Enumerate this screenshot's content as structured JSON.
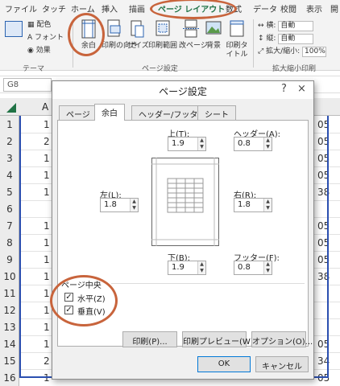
{
  "ribbon_tabs": [
    "ファイル",
    "タッチ",
    "ホーム",
    "挿入",
    "描画",
    "ページ レイアウト",
    "数式",
    "データ",
    "校閲",
    "表示",
    "開"
  ],
  "theme_group": {
    "colors": "配色",
    "fonts": "フォント",
    "effects": "効果",
    "label": "テーマ"
  },
  "page_setup_group": {
    "margins": "余白",
    "orientation": "印刷の向き",
    "size": "サイズ",
    "print_area": "印刷範囲",
    "breaks": "改ページ",
    "background": "背景",
    "print_titles": "印刷タイトル",
    "label": "ページ設定"
  },
  "scale_group": {
    "width_label": "横:",
    "width_value": "自動",
    "height_label": "縦:",
    "height_value": "自動",
    "scale_label": "拡大/縮小:",
    "scale_value": "100%",
    "label": "拡大縮小印刷"
  },
  "name_box": "G8",
  "column_header": "A",
  "row_numbers": [
    "1",
    "2",
    "3",
    "4",
    "5",
    "6",
    "7",
    "8",
    "9",
    "10",
    "11",
    "12",
    "13",
    "14",
    "15",
    "16"
  ],
  "col_a_values": [
    "1",
    "2",
    "1",
    "1",
    "1",
    "",
    "1",
    "1",
    "1",
    "1",
    "1",
    "1",
    "1",
    "1",
    "2",
    "1"
  ],
  "col_right_values": [
    "05",
    "05",
    "05",
    "05",
    "38",
    "",
    "05",
    "05",
    "05",
    "38",
    "",
    "",
    "",
    "05",
    "34",
    "05"
  ],
  "dialog": {
    "title": "ページ設定",
    "help": "?",
    "close": "×",
    "tabs": [
      "ページ",
      "余白",
      "ヘッダー/フッター",
      "シート"
    ],
    "top_label": "上(T):",
    "top_value": "1.9",
    "header_label": "ヘッダー(A):",
    "header_value": "0.8",
    "left_label": "左(L):",
    "left_value": "1.8",
    "right_label": "右(R):",
    "right_value": "1.8",
    "bottom_label": "下(B):",
    "bottom_value": "1.9",
    "footer_label": "フッター(F):",
    "footer_value": "0.8",
    "center_group_label": "ページ中央",
    "horizontal_label": "水平(Z)",
    "vertical_label": "垂直(V)",
    "print_button": "印刷(P)...",
    "preview_button": "印刷プレビュー(W)",
    "options_button": "オプション(O)...",
    "ok_button": "OK",
    "cancel_button": "キャンセル"
  },
  "accent_color": "#217346",
  "annotation_color": "#c8643c"
}
